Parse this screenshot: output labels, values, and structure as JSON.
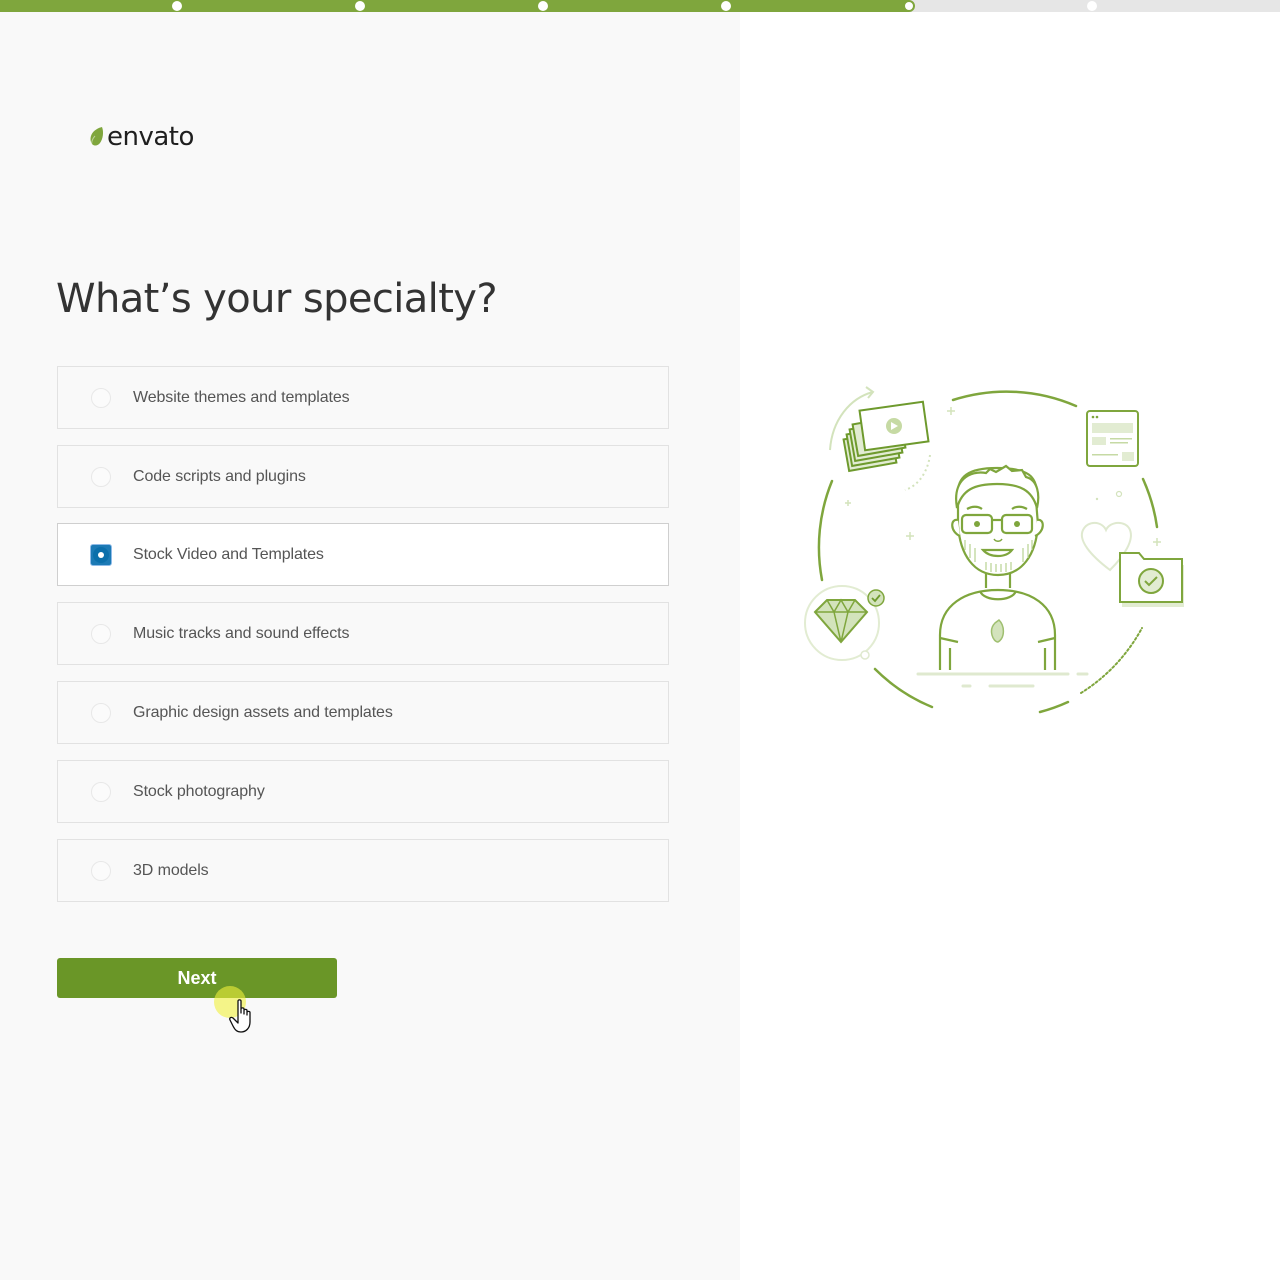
{
  "progress": {
    "total_steps": 6,
    "completed_fraction": 0.71,
    "current_step": 5
  },
  "brand": {
    "name": "envato",
    "accent_color": "#7fa63d",
    "button_color": "#6a9627",
    "selected_radio_color": "#0b6fab"
  },
  "question": {
    "title": "What’s your specialty?"
  },
  "options": [
    {
      "label": "Website themes and templates",
      "selected": false
    },
    {
      "label": "Code scripts and plugins",
      "selected": false
    },
    {
      "label": "Stock Video and Templates",
      "selected": true
    },
    {
      "label": "Music tracks and sound effects",
      "selected": false
    },
    {
      "label": "Graphic design assets and templates",
      "selected": false
    },
    {
      "label": "Stock photography",
      "selected": false
    },
    {
      "label": "3D models",
      "selected": false
    }
  ],
  "actions": {
    "next_label": "Next"
  },
  "illustration": {
    "icons": [
      "video-stack-icon",
      "website-template-icon",
      "heart-icon",
      "folder-check-icon",
      "diamond-icon",
      "person-avatar"
    ]
  }
}
